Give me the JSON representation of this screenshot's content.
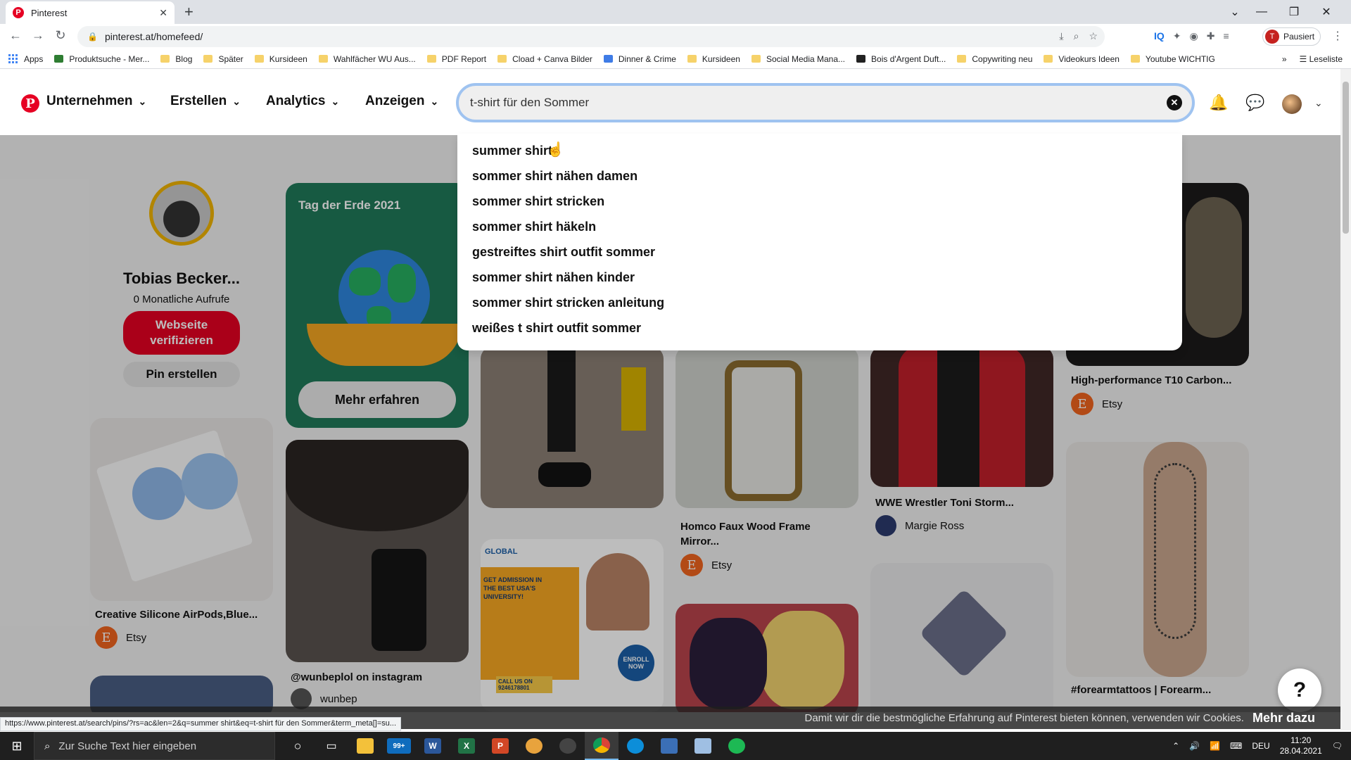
{
  "browser": {
    "tab_title": "Pinterest",
    "new_tab": "+",
    "url": "pinterest.at/homefeed/",
    "profile_letter": "T",
    "profile_status": "Pausiert",
    "bookmarks": [
      "Apps",
      "Produktsuche - Mer...",
      "Blog",
      "Später",
      "Kursideen",
      "Wahlfächer WU Aus...",
      "PDF Report",
      "Cload + Canva Bilder",
      "Dinner & Crime",
      "Kursideen",
      "Social Media Mana...",
      "Bois d'Argent Duft...",
      "Copywriting neu",
      "Videokurs Ideen",
      "Youtube WICHTIG"
    ],
    "bookmarks_more": "»",
    "reading_list": "Leseliste",
    "ext_iq": "IQ"
  },
  "header": {
    "logo": "P",
    "nav": [
      "Unternehmen",
      "Erstellen",
      "Analytics",
      "Anzeigen"
    ],
    "search_value": "t-shirt für den Sommer"
  },
  "suggestions": [
    "summer shirt",
    "sommer shirt nähen damen",
    "sommer shirt stricken",
    "sommer shirt häkeln",
    "gestreiftes shirt outfit sommer",
    "sommer shirt nähen kinder",
    "sommer shirt stricken anleitung",
    "weißes t shirt outfit sommer"
  ],
  "profile": {
    "name": "Tobias Becker...",
    "views": "0 Monatliche Aufrufe",
    "verify_button": "Webseite verifizieren",
    "create_pin_button": "Pin erstellen"
  },
  "pins": {
    "earth_label": "Tag der Erde 2021",
    "earth_cta": "Mehr erfahren",
    "p1_title": "Creative Silicone AirPods,Blue...",
    "p1_source": "Etsy",
    "p2_title": "@wunbeplol on instagram",
    "p2_source": "wunbep",
    "p3_title": "Homco Faux Wood Frame Mirror...",
    "p3_source": "Etsy",
    "p4_title": "WWE Wrestler Toni Storm...",
    "p4_source": "Margie Ross",
    "p5_title": "High-performance T10 Carbon...",
    "p5_source": "Etsy",
    "p6_title": "#forearmtattoos | Forearm...",
    "ad_text": "GET ADMISSION IN THE BEST USA'S UNIVERSITY!",
    "ad_call": "CALL US ON 9246178801",
    "ad_enroll": "ENROLL NOW",
    "ad_brand": "GLOBAL",
    "etsy_letter": "E"
  },
  "help": "?",
  "cookie": {
    "text": "Damit wir dir die bestmögliche Erfahrung auf Pinterest bieten können, verwenden wir Cookies.",
    "more": "Mehr dazu"
  },
  "status_url": "https://www.pinterest.at/search/pins/?rs=ac&len=2&q=summer shirt&eq=t-shirt für den Sommer&term_meta[]=su...",
  "taskbar": {
    "search_placeholder": "Zur Suche Text hier eingeben",
    "mail_badge": "99+",
    "lang": "DEU",
    "time": "11:20",
    "date": "28.04.2021"
  },
  "colors": {
    "pinterest_red": "#e60023",
    "focus_ring": "#9fc3f0",
    "etsy_orange": "#f1641e"
  }
}
